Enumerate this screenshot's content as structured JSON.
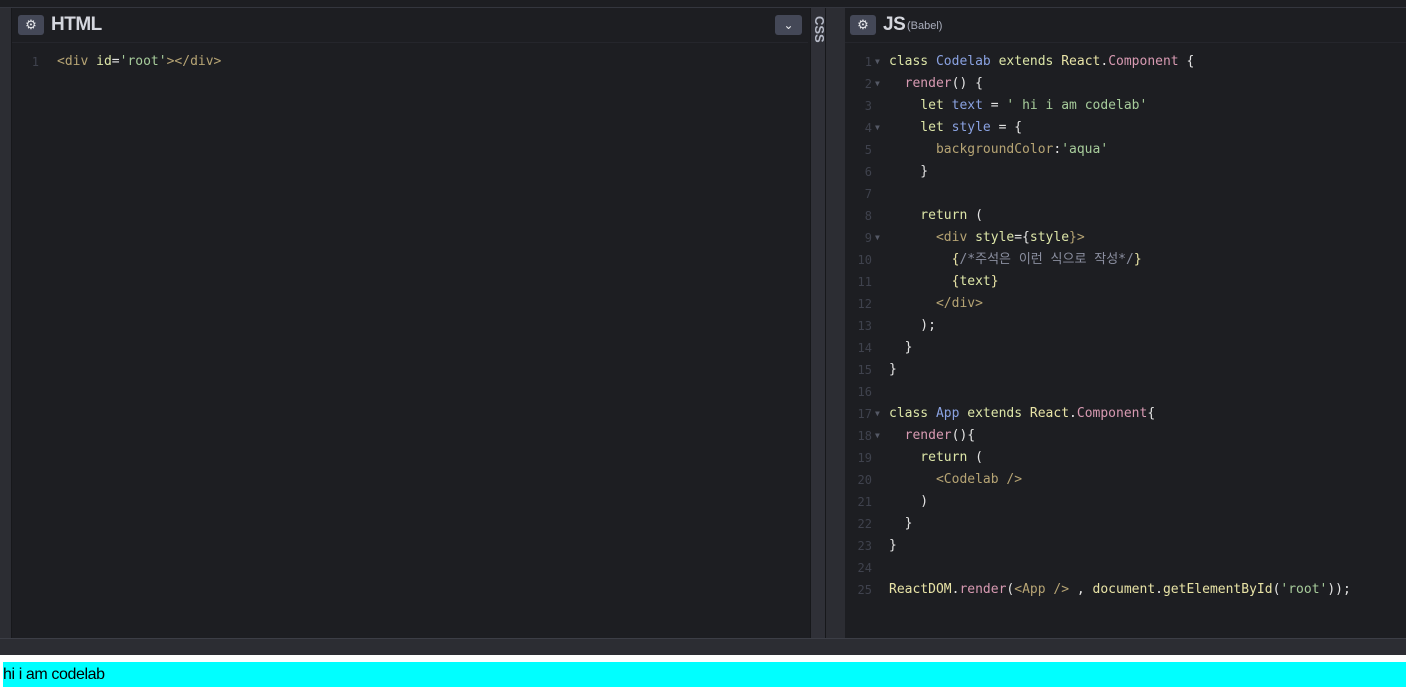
{
  "html_panel": {
    "title": "HTML",
    "settings_icon": "gear-icon",
    "collapse_icon": "chevron-down-icon",
    "lines": [
      {
        "n": "1",
        "fold": "",
        "tokens": [
          {
            "t": "<div ",
            "c": "tag"
          },
          {
            "t": "id",
            "c": "kw"
          },
          {
            "t": "=",
            "c": "pun"
          },
          {
            "t": "'root'",
            "c": "str"
          },
          {
            "t": "></div>",
            "c": "tag"
          }
        ]
      }
    ]
  },
  "css_panel": {
    "title": "CSS"
  },
  "js_panel": {
    "title": "JS",
    "subtitle": "(Babel)",
    "settings_icon": "gear-icon",
    "lines": [
      {
        "n": "1",
        "fold": "▼",
        "tokens": [
          {
            "t": "class ",
            "c": "kw"
          },
          {
            "t": "Codelab",
            "c": "cls"
          },
          {
            "t": " extends ",
            "c": "kw"
          },
          {
            "t": "React",
            "c": "id"
          },
          {
            "t": ".",
            "c": "pun"
          },
          {
            "t": "Component",
            "c": "fn"
          },
          {
            "t": " {",
            "c": "pun"
          }
        ]
      },
      {
        "n": "2",
        "fold": "▼",
        "tokens": [
          {
            "t": "  render",
            "c": "fn"
          },
          {
            "t": "() {",
            "c": "pun"
          }
        ]
      },
      {
        "n": "3",
        "fold": "",
        "tokens": [
          {
            "t": "    let ",
            "c": "kw"
          },
          {
            "t": "text",
            "c": "var"
          },
          {
            "t": " = ",
            "c": "pun"
          },
          {
            "t": "' hi i am codelab'",
            "c": "str"
          }
        ]
      },
      {
        "n": "4",
        "fold": "▼",
        "tokens": [
          {
            "t": "    let ",
            "c": "kw"
          },
          {
            "t": "style",
            "c": "var"
          },
          {
            "t": " = {",
            "c": "pun"
          }
        ]
      },
      {
        "n": "5",
        "fold": "",
        "tokens": [
          {
            "t": "      backgroundColor",
            "c": "tag"
          },
          {
            "t": ":",
            "c": "pun"
          },
          {
            "t": "'aqua'",
            "c": "str"
          }
        ]
      },
      {
        "n": "6",
        "fold": "",
        "tokens": [
          {
            "t": "    }",
            "c": "pun"
          }
        ]
      },
      {
        "n": "7",
        "fold": "",
        "tokens": []
      },
      {
        "n": "8",
        "fold": "",
        "tokens": [
          {
            "t": "    return ",
            "c": "kw"
          },
          {
            "t": "(",
            "c": "pun"
          }
        ]
      },
      {
        "n": "9",
        "fold": "▼",
        "tokens": [
          {
            "t": "      <div ",
            "c": "tag"
          },
          {
            "t": "style",
            "c": "kw"
          },
          {
            "t": "={",
            "c": "pun"
          },
          {
            "t": "style",
            "c": "kw"
          },
          {
            "t": "}>",
            "c": "tag"
          }
        ]
      },
      {
        "n": "10",
        "fold": "",
        "tokens": [
          {
            "t": "        {",
            "c": "id"
          },
          {
            "t": "/*주석은 이런 식으로 작성*/",
            "c": "cmt"
          },
          {
            "t": "}",
            "c": "id"
          }
        ]
      },
      {
        "n": "11",
        "fold": "",
        "tokens": [
          {
            "t": "        {",
            "c": "id"
          },
          {
            "t": "text",
            "c": "kw"
          },
          {
            "t": "}",
            "c": "id"
          }
        ]
      },
      {
        "n": "12",
        "fold": "",
        "tokens": [
          {
            "t": "      </div>",
            "c": "tag"
          }
        ]
      },
      {
        "n": "13",
        "fold": "",
        "tokens": [
          {
            "t": "    );",
            "c": "pun"
          }
        ]
      },
      {
        "n": "14",
        "fold": "",
        "tokens": [
          {
            "t": "  }",
            "c": "pun"
          }
        ]
      },
      {
        "n": "15",
        "fold": "",
        "tokens": [
          {
            "t": "}",
            "c": "pun"
          }
        ]
      },
      {
        "n": "16",
        "fold": "",
        "tokens": []
      },
      {
        "n": "17",
        "fold": "▼",
        "tokens": [
          {
            "t": "class ",
            "c": "kw"
          },
          {
            "t": "App",
            "c": "cls"
          },
          {
            "t": " extends ",
            "c": "kw"
          },
          {
            "t": "React",
            "c": "id"
          },
          {
            "t": ".",
            "c": "pun"
          },
          {
            "t": "Component",
            "c": "fn"
          },
          {
            "t": "{",
            "c": "pun"
          }
        ]
      },
      {
        "n": "18",
        "fold": "▼",
        "tokens": [
          {
            "t": "  render",
            "c": "fn"
          },
          {
            "t": "(){",
            "c": "pun"
          }
        ]
      },
      {
        "n": "19",
        "fold": "",
        "tokens": [
          {
            "t": "    return ",
            "c": "kw"
          },
          {
            "t": "(",
            "c": "pun"
          }
        ]
      },
      {
        "n": "20",
        "fold": "",
        "tokens": [
          {
            "t": "      <Codelab />",
            "c": "tag"
          }
        ]
      },
      {
        "n": "21",
        "fold": "",
        "tokens": [
          {
            "t": "    )",
            "c": "pun"
          }
        ]
      },
      {
        "n": "22",
        "fold": "",
        "tokens": [
          {
            "t": "  }",
            "c": "pun"
          }
        ]
      },
      {
        "n": "23",
        "fold": "",
        "tokens": [
          {
            "t": "}",
            "c": "pun"
          }
        ]
      },
      {
        "n": "24",
        "fold": "",
        "tokens": []
      },
      {
        "n": "25",
        "fold": "",
        "tokens": [
          {
            "t": "ReactDOM",
            "c": "id"
          },
          {
            "t": ".",
            "c": "pun"
          },
          {
            "t": "render",
            "c": "fn"
          },
          {
            "t": "(",
            "c": "pun"
          },
          {
            "t": "<App />",
            "c": "tag"
          },
          {
            "t": " , ",
            "c": "pun"
          },
          {
            "t": "document",
            "c": "id"
          },
          {
            "t": ".",
            "c": "pun"
          },
          {
            "t": "getElementById",
            "c": "id"
          },
          {
            "t": "(",
            "c": "pun"
          },
          {
            "t": "'root'",
            "c": "str"
          },
          {
            "t": "));",
            "c": "pun"
          }
        ]
      }
    ]
  },
  "preview": {
    "text": "hi i am codelab",
    "background": "#00ffff"
  }
}
